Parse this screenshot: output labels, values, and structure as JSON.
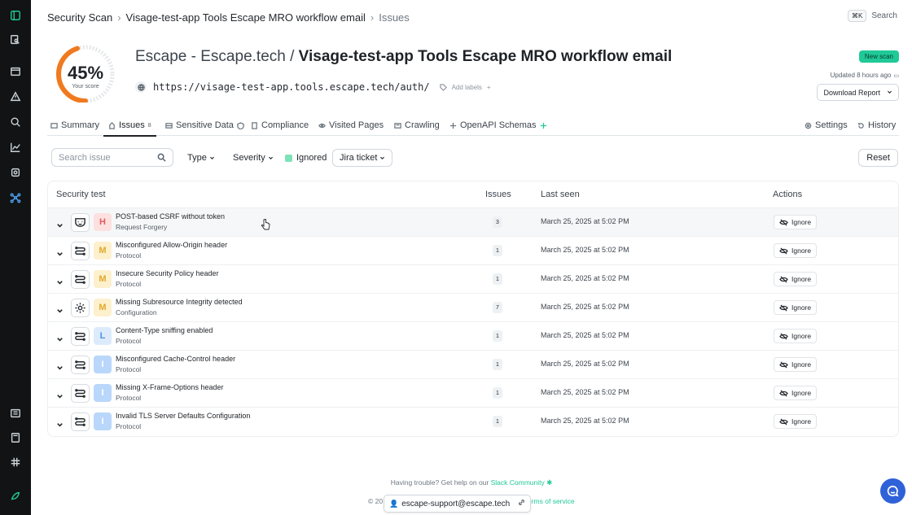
{
  "breadcrumb": {
    "items": [
      "Security Scan",
      "Visage-test-app Tools Escape MRO workflow email",
      "Issues"
    ]
  },
  "search": {
    "shortcut": "⌘K",
    "label": "Search"
  },
  "score": {
    "value": "45%",
    "label": "Your score",
    "fraction": 0.45,
    "color": "#f07a1f"
  },
  "header": {
    "org": "Escape - Escape.tech",
    "separator": "/",
    "app": "Visage-test-app Tools Escape MRO workflow email",
    "url": "https://visage-test-app.tools.escape.tech/auth/",
    "add_labels": "Add labels",
    "new_scan": "New scan",
    "updated": "Updated 8 hours ago",
    "download": "Download Report"
  },
  "tabs": [
    {
      "label": "Summary",
      "icon": "summary-icon"
    },
    {
      "label": "Issues",
      "icon": "issues-icon",
      "count": "8"
    },
    {
      "label": "Sensitive Data",
      "icon": "sensitive-data-icon"
    },
    {
      "label": "Compliance",
      "icon": "compliance-icon"
    },
    {
      "label": "Visited Pages",
      "icon": "visited-pages-icon"
    },
    {
      "label": "Crawling",
      "icon": "crawling-icon"
    },
    {
      "label": "OpenAPI Schemas",
      "icon": "openapi-icon"
    },
    {
      "label": "Settings",
      "icon": "gear-icon"
    },
    {
      "label": "History",
      "icon": "history-icon"
    }
  ],
  "filters": {
    "search_placeholder": "Search issue",
    "type": "Type",
    "severity": "Severity",
    "ignored": "Ignored",
    "jira": "Jira ticket",
    "reset": "Reset"
  },
  "table": {
    "headers": {
      "test": "Security test",
      "issues": "Issues",
      "last_seen": "Last seen",
      "actions": "Actions"
    },
    "rows": [
      {
        "name": "POST-based CSRF without token",
        "category": "Request Forgery",
        "severity": "H",
        "issues": "3",
        "last_seen": "March 25, 2025 at 5:02 PM",
        "action": "Ignore",
        "icon": "mask-icon"
      },
      {
        "name": "Misconfigured Allow-Origin header",
        "category": "Protocol",
        "severity": "M",
        "issues": "1",
        "last_seen": "March 25, 2025 at 5:02 PM",
        "action": "Ignore",
        "icon": "protocol-icon"
      },
      {
        "name": "Insecure Security Policy header",
        "category": "Protocol",
        "severity": "M",
        "issues": "1",
        "last_seen": "March 25, 2025 at 5:02 PM",
        "action": "Ignore",
        "icon": "protocol-icon"
      },
      {
        "name": "Missing Subresource Integrity detected",
        "category": "Configuration",
        "severity": "M",
        "issues": "7",
        "last_seen": "March 25, 2025 at 5:02 PM",
        "action": "Ignore",
        "icon": "gear-icon"
      },
      {
        "name": "Content-Type sniffing enabled",
        "category": "Protocol",
        "severity": "L",
        "issues": "1",
        "last_seen": "March 25, 2025 at 5:02 PM",
        "action": "Ignore",
        "icon": "protocol-icon"
      },
      {
        "name": "Misconfigured Cache-Control header",
        "category": "Protocol",
        "severity": "I",
        "issues": "1",
        "last_seen": "March 25, 2025 at 5:02 PM",
        "action": "Ignore",
        "icon": "protocol-icon"
      },
      {
        "name": "Missing X-Frame-Options header",
        "category": "Protocol",
        "severity": "I",
        "issues": "1",
        "last_seen": "March 25, 2025 at 5:02 PM",
        "action": "Ignore",
        "icon": "protocol-icon"
      },
      {
        "name": "Invalid TLS Server Defaults Configuration",
        "category": "Protocol",
        "severity": "I",
        "issues": "1",
        "last_seen": "March 25, 2025 at 5:02 PM",
        "action": "Ignore",
        "icon": "protocol-icon"
      }
    ]
  },
  "footer": {
    "help": "Having trouble? Get help on our",
    "slack": "Slack Community",
    "copyright": "© 20",
    "terms": "erms of service",
    "support_email": "escape-support@escape.tech"
  }
}
